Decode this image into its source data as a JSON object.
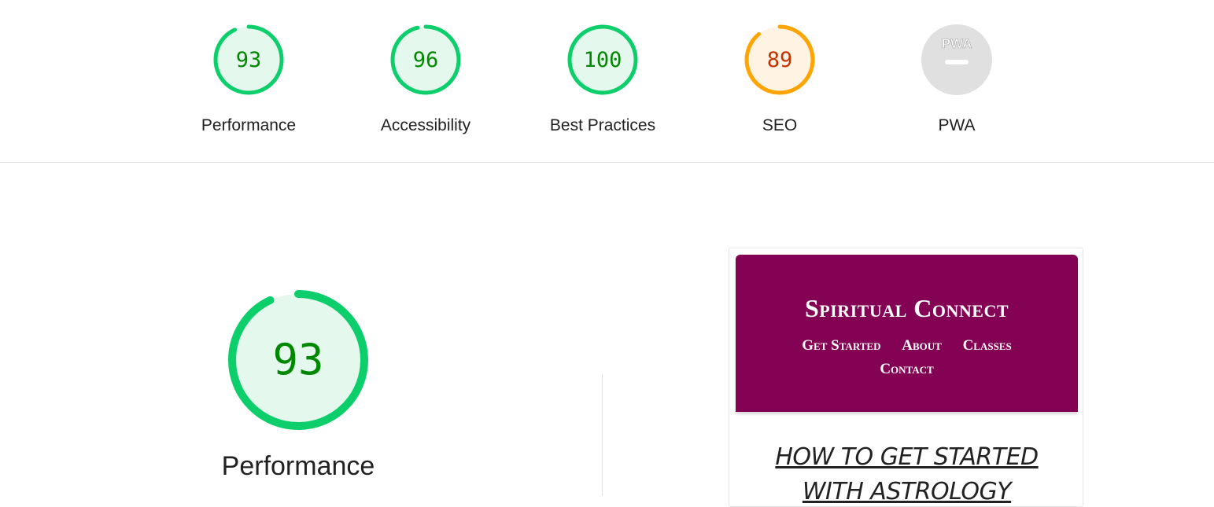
{
  "summary": {
    "categories": [
      {
        "label": "Performance",
        "score": "93",
        "fraction": 0.93,
        "status": "pass"
      },
      {
        "label": "Accessibility",
        "score": "96",
        "fraction": 0.96,
        "status": "pass"
      },
      {
        "label": "Best Practices",
        "score": "100",
        "fraction": 1.0,
        "status": "pass"
      },
      {
        "label": "SEO",
        "score": "89",
        "fraction": 0.89,
        "status": "average"
      },
      {
        "label": "PWA",
        "badge": "PWA",
        "status": "na"
      }
    ]
  },
  "main": {
    "score": "93",
    "fraction": 0.93,
    "title": "Performance"
  },
  "screenshot": {
    "site_title": "Spiritual Connect",
    "nav": [
      "Get Started",
      "About",
      "Classes",
      "Contact"
    ],
    "heading_line1": "How to Get Started",
    "heading_line2": "with Astrology"
  },
  "colors": {
    "pass": "#0cce6b",
    "pass_text": "#008800",
    "pass_bg": "#e5f8ee",
    "average": "#ffa400",
    "average_text": "#c33300",
    "average_bg": "#fff4e3",
    "na": "#e0e0e0",
    "na_text": "#9e9e9e",
    "site_header": "#830254"
  }
}
